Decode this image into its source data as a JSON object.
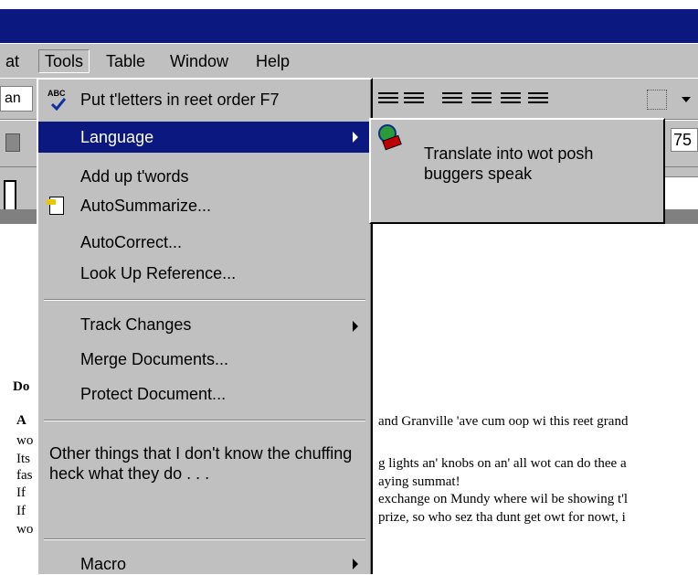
{
  "menubar": {
    "items": [
      {
        "label": "at"
      },
      {
        "label": "Tools"
      },
      {
        "label": "Table"
      },
      {
        "label": "Window"
      },
      {
        "label": "Help"
      }
    ]
  },
  "toolbar": {
    "font_fragment": "an",
    "zoom_value": "75"
  },
  "tools_menu": {
    "items": [
      {
        "label": "Put t'letters in reet order F7",
        "icon": "spellcheck-icon"
      },
      {
        "label": "Language",
        "has_submenu": true,
        "highlighted": true
      },
      {
        "label": "Add up t'words"
      },
      {
        "label": "AutoSummarize...",
        "icon": "autosummarize-icon"
      },
      {
        "label": "AutoCorrect..."
      },
      {
        "label": "Look Up Reference..."
      },
      {
        "label": "Track Changes",
        "has_submenu": true
      },
      {
        "label": "Merge Documents..."
      },
      {
        "label": "Protect Document..."
      },
      {
        "label": "Other things that I don't know the chuffing heck what they do . . ."
      },
      {
        "label": "Macro",
        "has_submenu": true
      }
    ]
  },
  "language_submenu": {
    "items": [
      {
        "label": "Translate into wot posh buggers speak",
        "icon": "globe-book-icon"
      }
    ]
  },
  "document": {
    "lines": [
      "and Granville 'ave cum oop wi this reet grand",
      "g lights an' knobs on an' all wot can do thee a",
      "aying summat!",
      "exchange on Mundy where wil be showing t'l",
      "prize, so who sez tha dunt get owt for nowt, i"
    ],
    "left_fragments": [
      "Do",
      "A",
      "wo",
      "Its",
      "fas",
      "If",
      "If",
      "wo"
    ]
  }
}
